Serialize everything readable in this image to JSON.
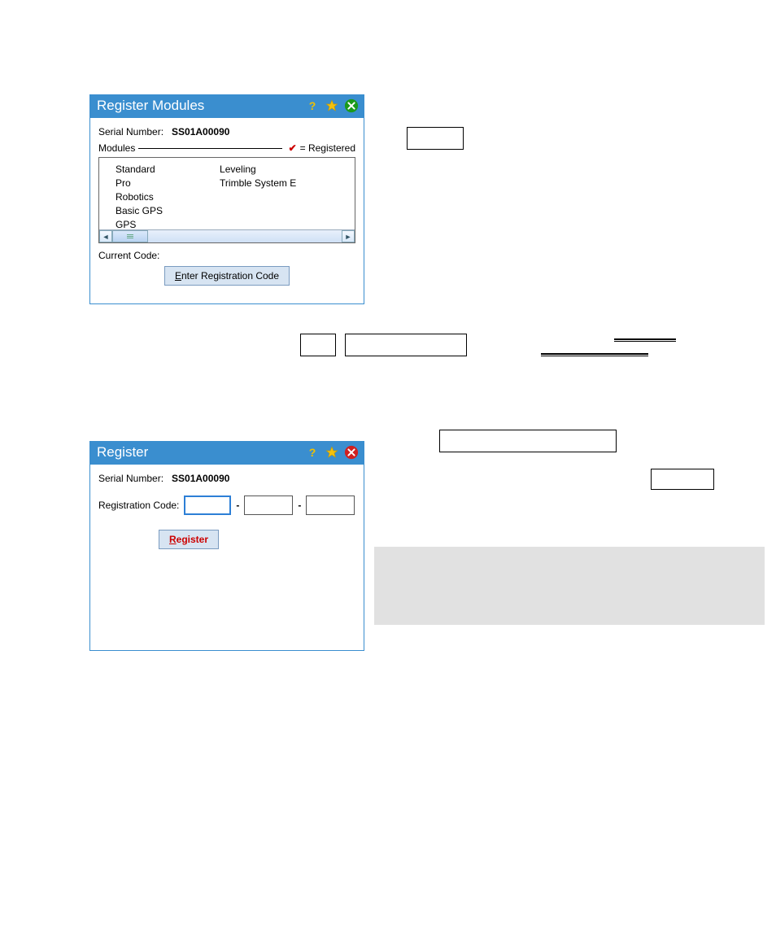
{
  "dialog1": {
    "title": "Register Modules",
    "serial_label": "Serial Number:",
    "serial_value": "SS01A00090",
    "modules_label": "Modules",
    "registered_suffix": " = Registered",
    "modules_col1": [
      "Standard",
      "Pro",
      "Robotics",
      "Basic GPS",
      "GPS"
    ],
    "modules_col2": [
      "Leveling",
      "Trimble System E"
    ],
    "current_code_label": "Current Code:",
    "enter_btn_prefix": "E",
    "enter_btn_rest": "nter Registration Code"
  },
  "dialog2": {
    "title": "Register",
    "serial_label": "Serial Number:",
    "serial_value": "SS01A00090",
    "reg_code_label": "Registration Code:",
    "register_btn_prefix": "R",
    "register_btn_rest": "egister"
  }
}
